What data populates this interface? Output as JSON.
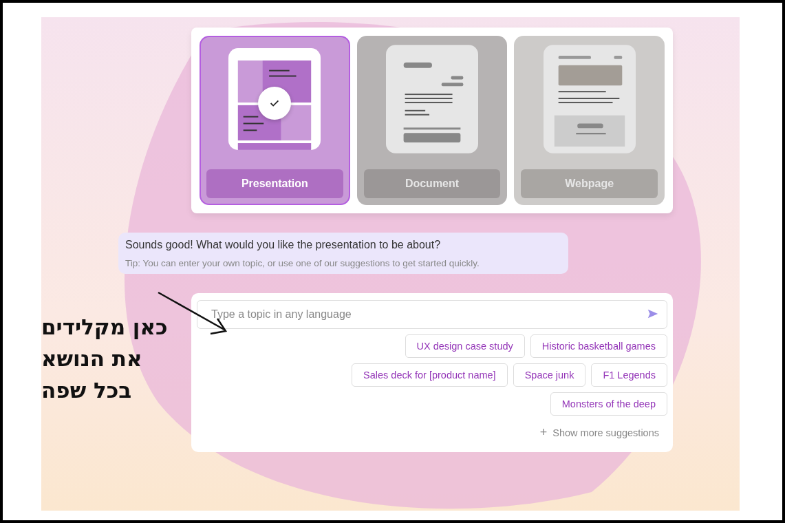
{
  "formats": [
    {
      "label": "Presentation",
      "kind": "slides",
      "selected": true
    },
    {
      "label": "Document",
      "kind": "doc",
      "selected": false
    },
    {
      "label": "Webpage",
      "kind": "web",
      "selected": false
    }
  ],
  "message": {
    "text": "Sounds good! What would you like the presentation to be about?",
    "tip": "Tip: You can enter your own topic, or use one of our suggestions to get started quickly."
  },
  "topic_input": {
    "placeholder": "Type a topic in any language"
  },
  "suggestions": [
    [
      "UX design case study",
      "Historic basketball games"
    ],
    [
      "Sales deck for [product name]",
      "Space junk",
      "F1 Legends"
    ],
    [
      "Monsters of the deep"
    ]
  ],
  "show_more": {
    "icon": "+",
    "label": "Show more suggestions"
  },
  "annotation": {
    "lines": [
      "כאן מקלידים",
      "את הנושא",
      "בכל שפה"
    ]
  }
}
